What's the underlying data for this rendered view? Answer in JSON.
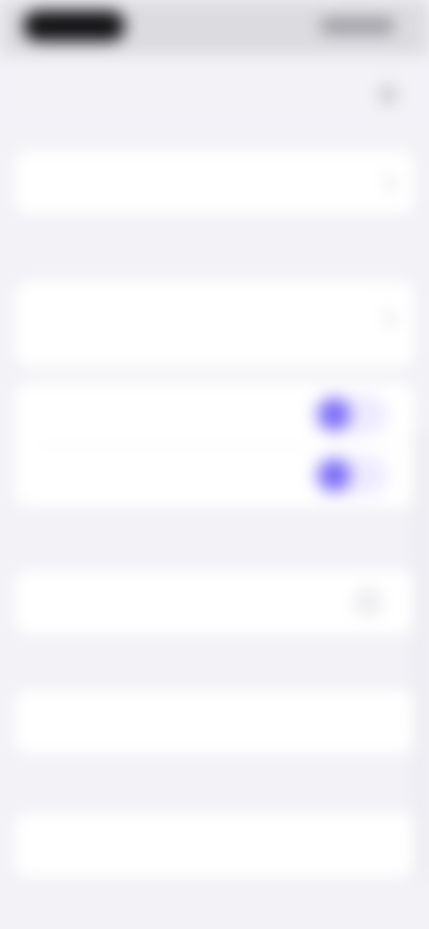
{
  "colors": {
    "background": "#f2f2f7",
    "card": "#ffffff",
    "accent": "#7c6cf6",
    "secondary_text": "#8e8e93"
  },
  "icons": {
    "nav_action": "ellipsis-icon",
    "row_chevron": "chevron-right-icon",
    "info": "info-icon"
  },
  "toggles": {
    "first_on": true,
    "second_on": true
  },
  "scroll": {
    "position_fraction": 0.45
  }
}
